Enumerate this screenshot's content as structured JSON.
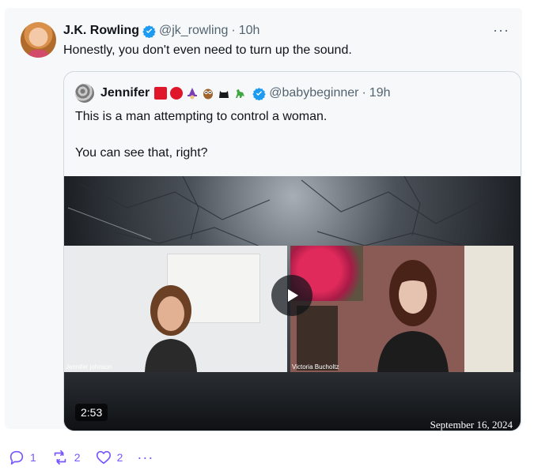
{
  "tweet": {
    "author_name": "J.K. Rowling",
    "handle": "@jk_rowling",
    "separator": "·",
    "time": "10h",
    "text": "Honestly, you don't even need to turn up the sound.",
    "more_label": "···"
  },
  "quote": {
    "author_name": "Jennifer",
    "handle": "@babybeginner",
    "separator": "·",
    "time": "19h",
    "text_line1": "This is a man attempting to control a woman.",
    "text_line2": "You can see that, right?"
  },
  "video": {
    "duration": "2:53",
    "date": "September 16, 2024",
    "left_label": "Jennifer johnson",
    "right_label": "Victoria Bucholtz"
  },
  "actions": {
    "reply_count": "1",
    "retweet_count": "2",
    "like_count": "2",
    "more_label": "···"
  },
  "icons": {
    "verified": "verified-badge-icon",
    "reply": "reply-icon",
    "retweet": "retweet-icon",
    "like": "heart-icon",
    "play": "play-icon"
  },
  "colors": {
    "verified": "#1d9bf0",
    "action_accent": "#7856ff"
  }
}
